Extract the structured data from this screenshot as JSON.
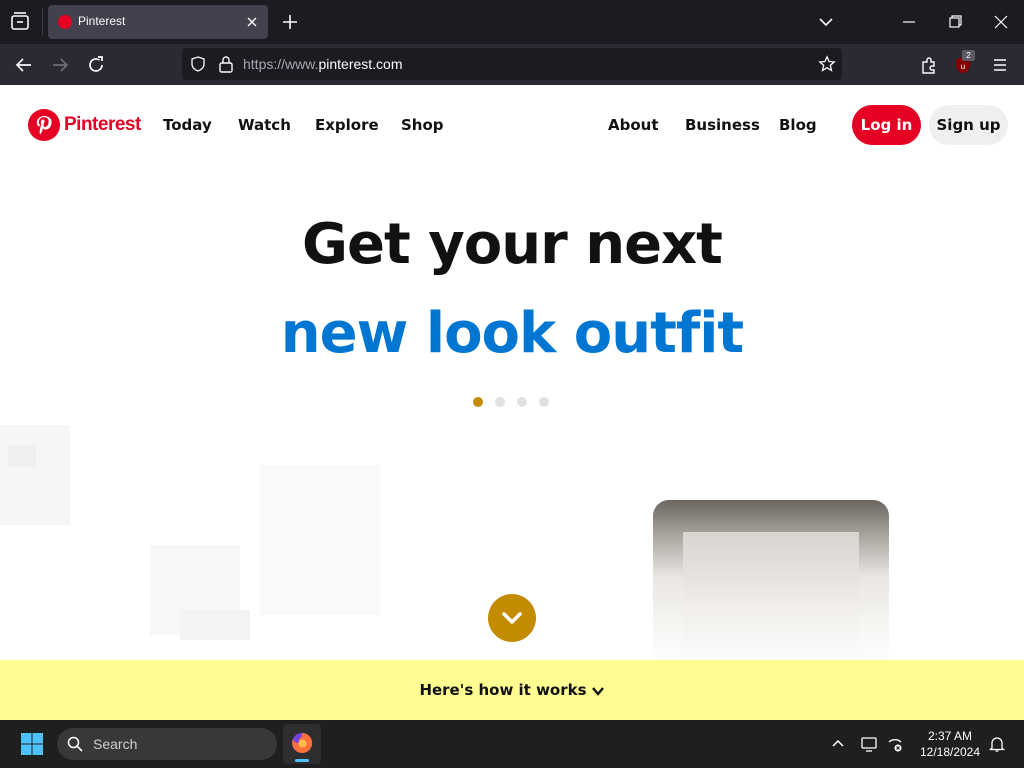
{
  "browser": {
    "tab_title": "Pinterest",
    "url_prefix": "https://www.",
    "url_domain": "pinterest.com",
    "extension_badge": "2"
  },
  "site": {
    "logo_text": "Pinterest",
    "nav_left": [
      "Today",
      "Watch",
      "Explore",
      "Shop"
    ],
    "nav_right": [
      "About",
      "Business",
      "Blog"
    ],
    "login_label": "Log in",
    "signup_label": "Sign up"
  },
  "hero": {
    "line1": "Get your next",
    "line2": "new look outfit",
    "line2_color": "#0076d3",
    "carousel_total": 4,
    "carousel_active": 1,
    "accent_color": "#c28b00"
  },
  "how_it_works": {
    "label": "Here's how it works"
  },
  "taskbar": {
    "search_placeholder": "Search",
    "time": "2:37 AM",
    "date": "12/18/2024"
  },
  "colors": {
    "brand": "#e60023",
    "banner": "#fffd92"
  }
}
